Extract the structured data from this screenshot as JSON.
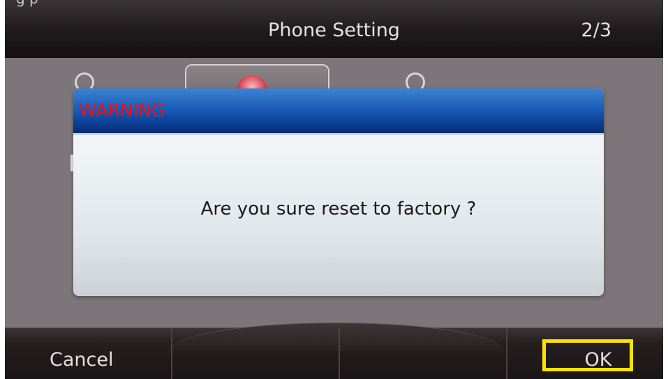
{
  "window": {
    "title": "Phone Setting",
    "page_indicator": "2/3",
    "clipped_text": "g p"
  },
  "dialog": {
    "title": "WARNING",
    "message": "Are you sure reset to factory ?",
    "title_color": "#e6121f",
    "header_color": "#1b5db8"
  },
  "background_icons": [
    {
      "name": "settings-item-icon"
    },
    {
      "name": "reset-icon"
    },
    {
      "name": "settings-item-icon"
    }
  ],
  "softkeys": {
    "items": [
      {
        "label": "Cancel"
      },
      {
        "label": ""
      },
      {
        "label": ""
      },
      {
        "label": "OK"
      }
    ],
    "highlight_color": "#ffe100"
  }
}
